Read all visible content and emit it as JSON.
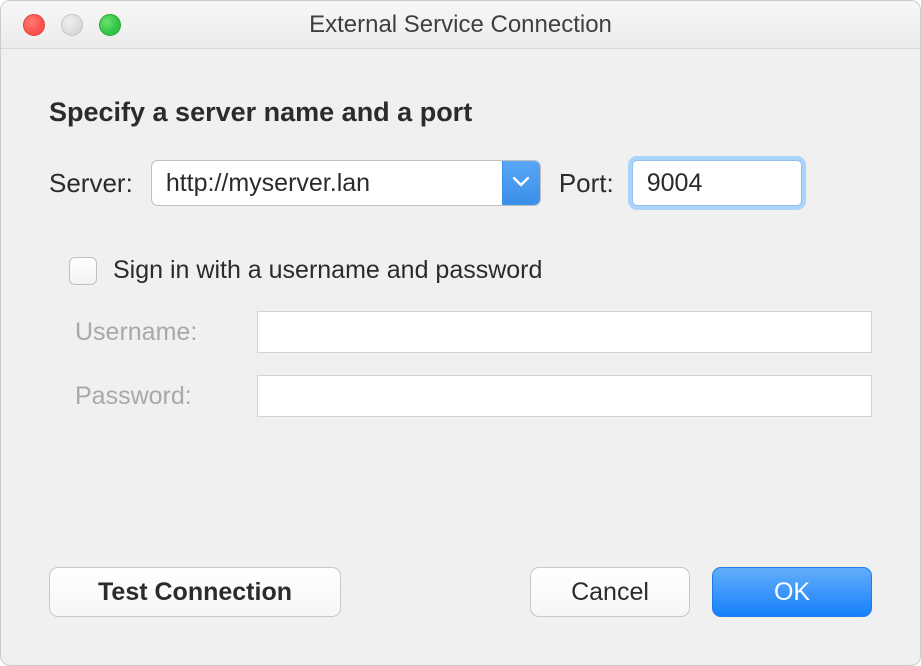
{
  "window": {
    "title": "External Service Connection"
  },
  "heading": "Specify a server name and a port",
  "server": {
    "label": "Server:",
    "value": "http://myserver.lan"
  },
  "port": {
    "label": "Port:",
    "value": "9004"
  },
  "signin": {
    "checkbox_label": "Sign in with a username and password",
    "checked": false,
    "username_label": "Username:",
    "username_value": "",
    "password_label": "Password:",
    "password_value": ""
  },
  "buttons": {
    "test": "Test Connection",
    "cancel": "Cancel",
    "ok": "OK"
  }
}
